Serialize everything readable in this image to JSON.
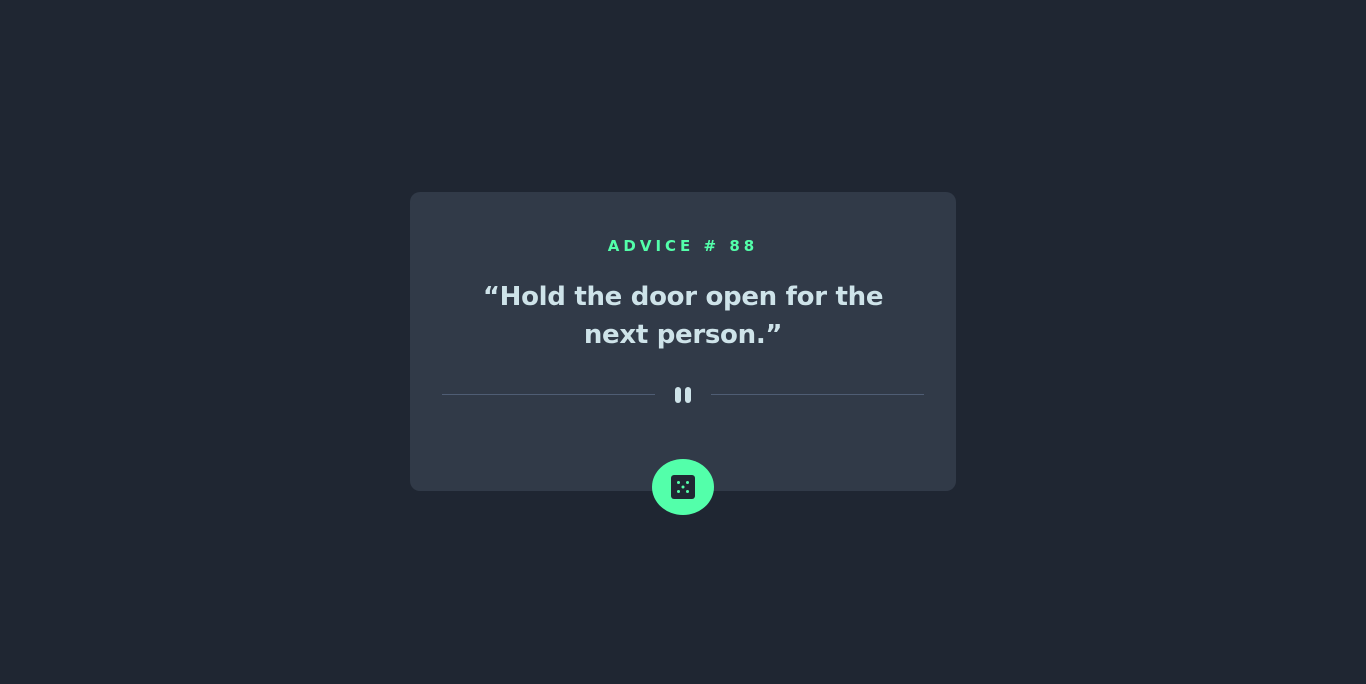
{
  "advice": {
    "label": "ADVICE # 88",
    "quote": "“Hold the door open for the next person.”"
  },
  "colors": {
    "background": "#1f2632",
    "card": "#313a48",
    "accent": "#53ffaa",
    "quote_text": "#cee3e9",
    "divider": "#4f5d74"
  },
  "icons": {
    "divider": "pause-icon",
    "button": "dice-icon"
  }
}
